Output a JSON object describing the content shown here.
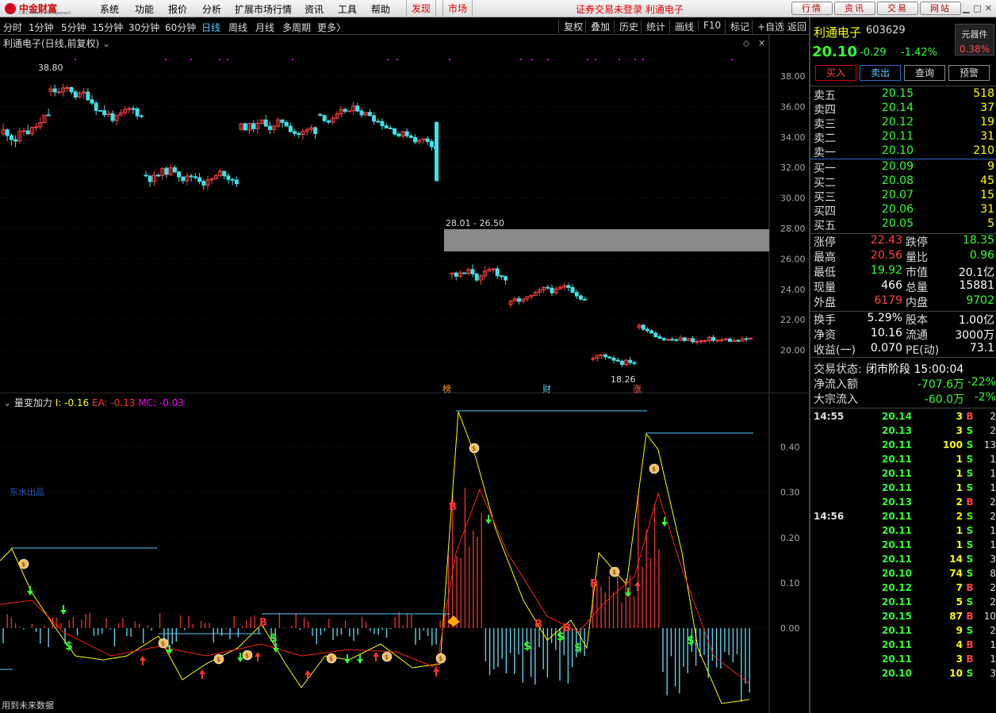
{
  "app": {
    "logo_name": "中金财富",
    "logo_sub": "CICC Wealth Management",
    "menu": [
      "系统",
      "功能",
      "报价",
      "分析",
      "扩展市场行情",
      "资讯",
      "工具",
      "帮助"
    ],
    "hot": [
      "发现",
      "市场"
    ],
    "login_status": "证券交易未登录",
    "stock_name_top": "利通电子",
    "top_buttons": [
      "行情",
      "资讯",
      "交易",
      "网站"
    ]
  },
  "toolbar": {
    "periods": [
      "分时",
      "1分钟",
      "5分钟",
      "15分钟",
      "30分钟",
      "60分钟",
      "日线",
      "周线",
      "月线",
      "多周期",
      "更多〉"
    ],
    "active": "日线",
    "tools": [
      "复权",
      "叠加",
      "历史",
      "统计",
      "画线",
      "F10",
      "标记",
      "+自选",
      "返回"
    ]
  },
  "chart": {
    "title": "利通电子(日线,前复权)",
    "high_label": "38.80",
    "low_label": "18.26",
    "gap_label": "28.01 - 26.50",
    "y_ticks": [
      "38.00",
      "36.00",
      "34.00",
      "32.00",
      "30.00",
      "28.00",
      "26.00",
      "24.00",
      "22.00",
      "20.00"
    ],
    "markers": [
      "榜",
      "财",
      "涨"
    ]
  },
  "indicator": {
    "name": "量变加力",
    "i_label": "I: -0.16",
    "ea_label": "EA: -0.13",
    "mc_label": "MC: -0.03",
    "y_ticks": [
      "0.40",
      "0.30",
      "0.20",
      "0.10",
      "0.00"
    ],
    "watermark": "东水出品",
    "future_note": "用到未来数据"
  },
  "colors": {
    "up": "#ff4040",
    "down": "#40e0e8",
    "i_line": "#ffff00",
    "ea_line": "#ff2020"
  },
  "quote": {
    "name": "利通电子",
    "code": "603629",
    "tag": "元器件",
    "tag_pct": "0.38%",
    "price": "20.10",
    "change": "-0.29",
    "change_pct": "-1.42%",
    "buttons": [
      "买入",
      "卖出",
      "查询",
      "预警"
    ],
    "asks": [
      {
        "label": "卖五",
        "price": "20.15",
        "vol": "518"
      },
      {
        "label": "卖四",
        "price": "20.14",
        "vol": "37"
      },
      {
        "label": "卖三",
        "price": "20.12",
        "vol": "19"
      },
      {
        "label": "卖二",
        "price": "20.11",
        "vol": "31"
      },
      {
        "label": "卖一",
        "price": "20.10",
        "vol": "210"
      }
    ],
    "bids": [
      {
        "label": "买一",
        "price": "20.09",
        "vol": "9"
      },
      {
        "label": "买二",
        "price": "20.08",
        "vol": "45"
      },
      {
        "label": "买三",
        "price": "20.07",
        "vol": "15"
      },
      {
        "label": "买四",
        "price": "20.06",
        "vol": "31"
      },
      {
        "label": "买五",
        "price": "20.05",
        "vol": "5"
      }
    ],
    "stats": [
      {
        "l1": "涨停",
        "v1": "22.43",
        "c1": "red",
        "l2": "跌停",
        "v2": "18.35",
        "c2": "green"
      },
      {
        "l1": "最高",
        "v1": "20.56",
        "c1": "red",
        "l2": "量比",
        "v2": "0.96",
        "c2": "green"
      },
      {
        "l1": "最低",
        "v1": "19.92",
        "c1": "green",
        "l2": "市值",
        "v2": "20.1亿",
        "c2": "white"
      },
      {
        "l1": "现量",
        "v1": "466",
        "c1": "white",
        "l2": "总量",
        "v2": "15881",
        "c2": "white"
      },
      {
        "l1": "外盘",
        "v1": "6179",
        "c1": "red",
        "l2": "内盘",
        "v2": "9702",
        "c2": "green"
      }
    ],
    "stats2": [
      {
        "l1": "换手",
        "v1": "5.29%",
        "l2": "股本",
        "v2": "1.00亿"
      },
      {
        "l1": "净资",
        "v1": "10.16",
        "l2": "流通",
        "v2": "3000万"
      },
      {
        "l1": "收益(一)",
        "v1": "0.070",
        "l2": "PE(动)",
        "v2": "73.1"
      }
    ],
    "trade_status_label": "交易状态:",
    "trade_status": "闭市阶段 15:00:04",
    "net_inflow_label": "净流入额",
    "net_inflow": "-707.6万",
    "net_inflow_pct": "-22%",
    "block_inflow_label": "大宗流入",
    "block_inflow": "-60.0万",
    "block_inflow_pct": "-2%"
  },
  "ticks": [
    {
      "time": "14:55",
      "price": "20.14",
      "vol": "3",
      "bs": "B",
      "cnt": "2"
    },
    {
      "time": "",
      "price": "20.13",
      "vol": "3",
      "bs": "S",
      "cnt": "2"
    },
    {
      "time": "",
      "price": "20.11",
      "vol": "100",
      "bs": "S",
      "cnt": "13"
    },
    {
      "time": "",
      "price": "20.11",
      "vol": "1",
      "bs": "S",
      "cnt": "1"
    },
    {
      "time": "",
      "price": "20.11",
      "vol": "1",
      "bs": "S",
      "cnt": "1"
    },
    {
      "time": "",
      "price": "20.11",
      "vol": "1",
      "bs": "S",
      "cnt": "1"
    },
    {
      "time": "",
      "price": "20.13",
      "vol": "2",
      "bs": "B",
      "cnt": "2"
    },
    {
      "time": "14:56",
      "price": "20.11",
      "vol": "2",
      "bs": "S",
      "cnt": "2"
    },
    {
      "time": "",
      "price": "20.11",
      "vol": "1",
      "bs": "S",
      "cnt": "1"
    },
    {
      "time": "",
      "price": "20.11",
      "vol": "1",
      "bs": "S",
      "cnt": "1"
    },
    {
      "time": "",
      "price": "20.11",
      "vol": "14",
      "bs": "S",
      "cnt": "3"
    },
    {
      "time": "",
      "price": "20.10",
      "vol": "74",
      "bs": "S",
      "cnt": "8"
    },
    {
      "time": "",
      "price": "20.12",
      "vol": "7",
      "bs": "B",
      "cnt": "2"
    },
    {
      "time": "",
      "price": "20.11",
      "vol": "5",
      "bs": "S",
      "cnt": "2"
    },
    {
      "time": "",
      "price": "20.15",
      "vol": "87",
      "bs": "B",
      "cnt": "10"
    },
    {
      "time": "",
      "price": "20.11",
      "vol": "9",
      "bs": "S",
      "cnt": "2"
    },
    {
      "time": "",
      "price": "20.11",
      "vol": "4",
      "bs": "B",
      "cnt": "1"
    },
    {
      "time": "",
      "price": "20.11",
      "vol": "3",
      "bs": "B",
      "cnt": "1"
    },
    {
      "time": "",
      "price": "20.10",
      "vol": "10",
      "bs": "S",
      "cnt": "3"
    }
  ]
}
